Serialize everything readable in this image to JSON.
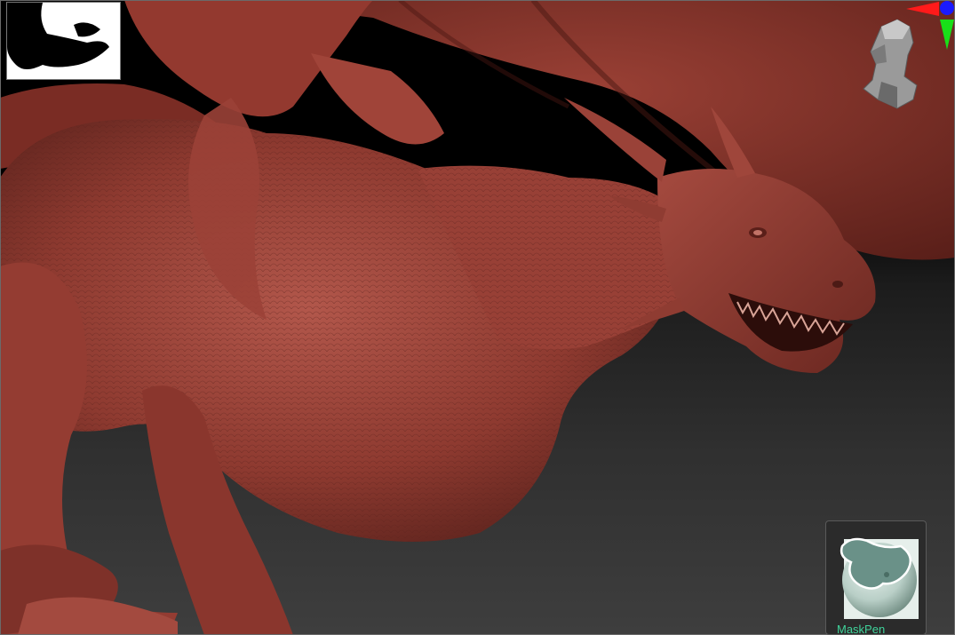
{
  "viewport": {
    "background_top": "#000000",
    "background_bottom": "#3e3e3e",
    "model_color": "#8e3a30"
  },
  "gizmo": {
    "axis_x_color": "#ff1a1a",
    "axis_y_color": "#19e019",
    "axis_z_color": "#1a1aff",
    "icon": "head-orientation-icon"
  },
  "brush": {
    "name": "MaskPen",
    "icon": "maskpen-brush-icon",
    "label_color": "#3fd29a"
  }
}
